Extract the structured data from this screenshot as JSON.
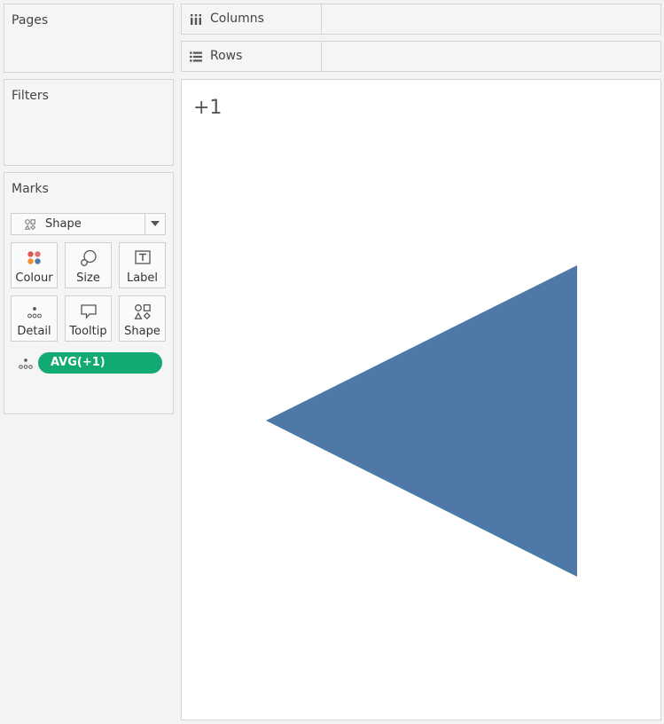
{
  "cards": {
    "pages_title": "Pages",
    "filters_title": "Filters",
    "marks_title": "Marks"
  },
  "shelves": {
    "columns_label": "Columns",
    "columns_icon": "columns-icon",
    "rows_label": "Rows",
    "rows_icon": "rows-icon"
  },
  "marks": {
    "mark_type": "Shape",
    "buttons": [
      {
        "label": "Colour",
        "icon": "colour-icon"
      },
      {
        "label": "Size",
        "icon": "size-icon"
      },
      {
        "label": "Label",
        "icon": "label-icon"
      },
      {
        "label": "Detail",
        "icon": "detail-icon"
      },
      {
        "label": "Tooltip",
        "icon": "tooltip-icon"
      },
      {
        "label": "Shape",
        "icon": "shape-icon"
      }
    ],
    "pill": {
      "label": "AVG(+1)",
      "color": "#12aa73",
      "encoding_icon": "detail-icon"
    }
  },
  "view": {
    "header": "+1",
    "mark_color": "#4e79a7",
    "mark_shape": "left-pointing-triangle"
  }
}
